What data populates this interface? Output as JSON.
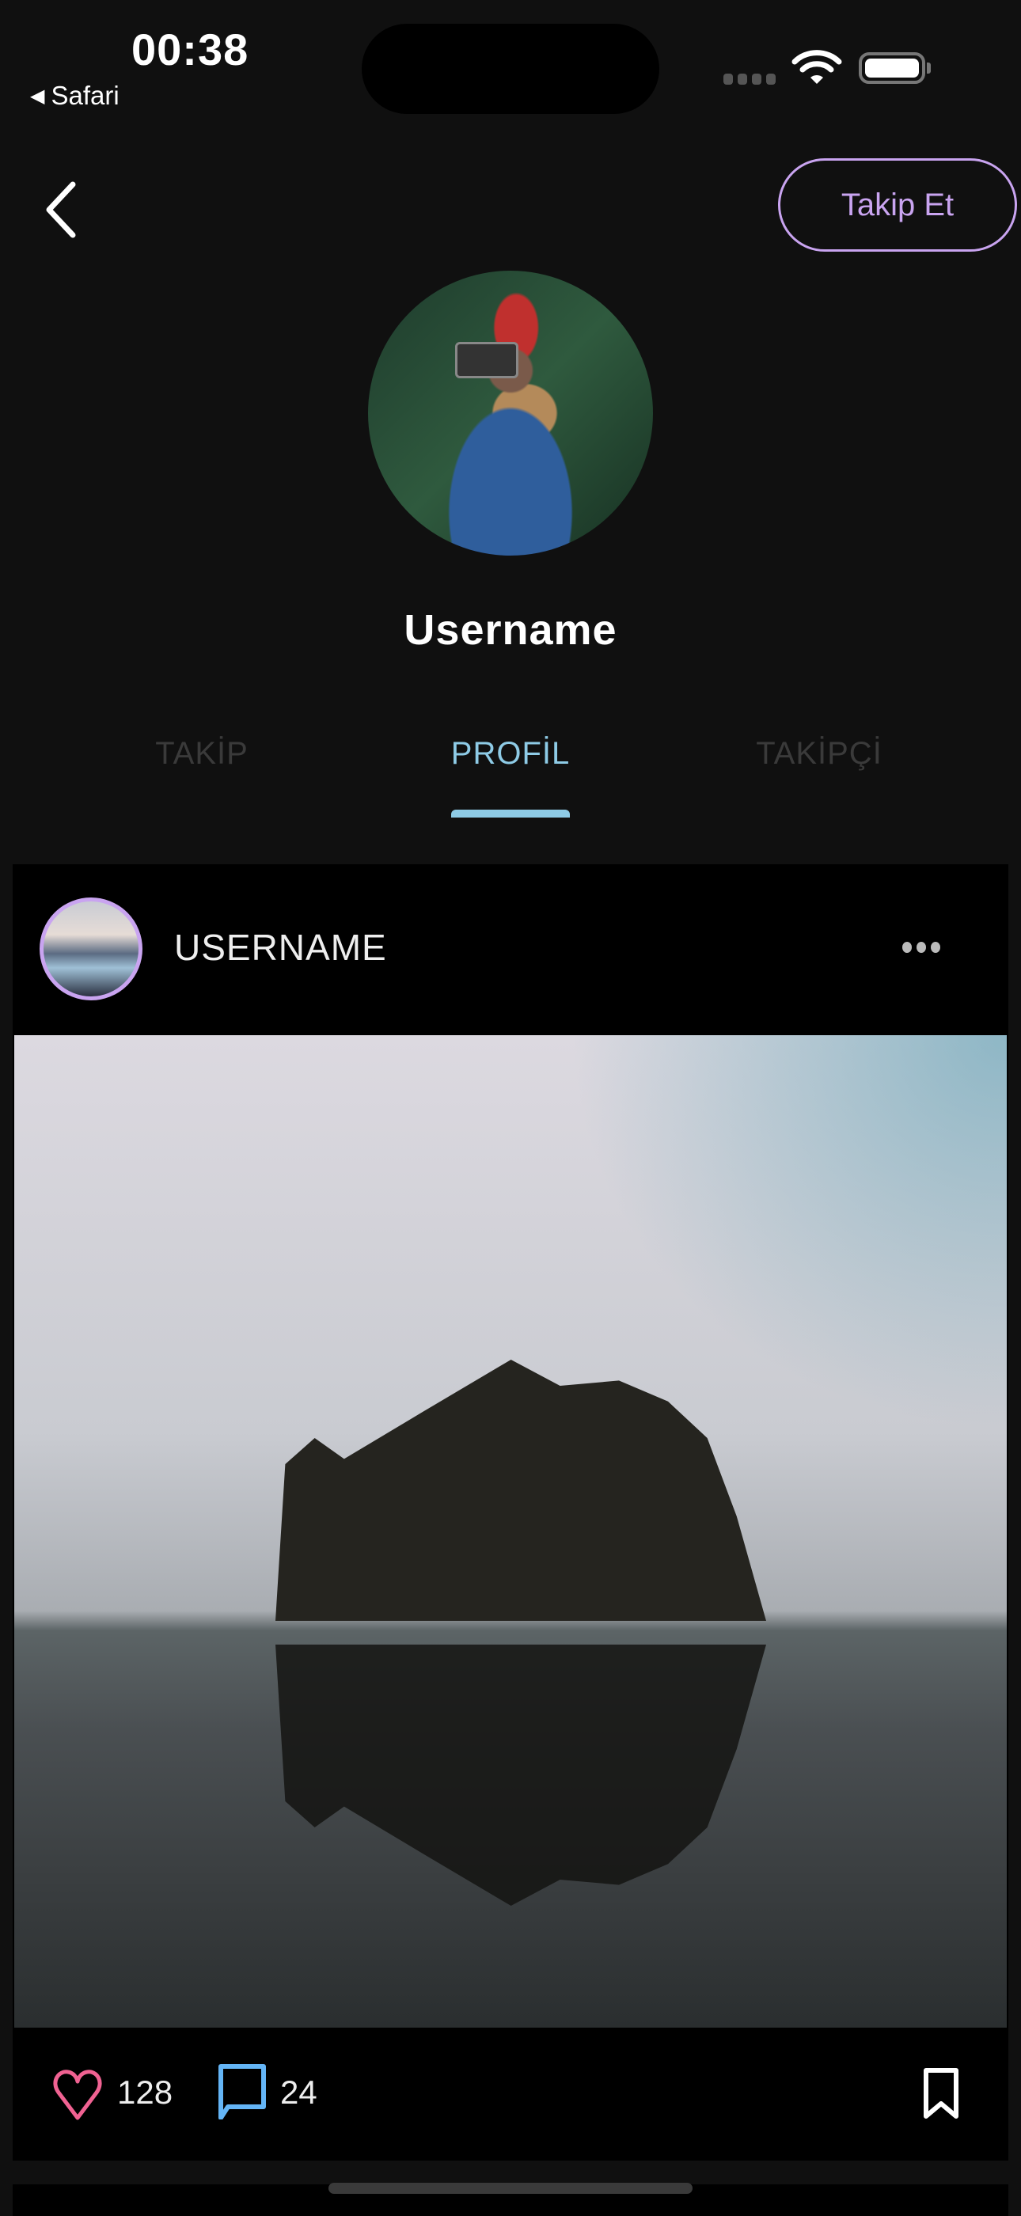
{
  "status_bar": {
    "time": "00:38",
    "back_app": "Safari"
  },
  "header": {
    "follow_label": "Takip Et"
  },
  "profile": {
    "username": "Username"
  },
  "tabs": [
    {
      "label": "TAKİP",
      "active": false
    },
    {
      "label": "PROFİL",
      "active": true
    },
    {
      "label": "TAKİPÇİ",
      "active": false
    }
  ],
  "post": {
    "username": "USERNAME",
    "likes": "128",
    "comments": "24"
  },
  "colors": {
    "accent_purple": "#c9a4f0",
    "tab_active": "#8ecbe6",
    "like": "#f06292",
    "comment": "#64b5f6"
  }
}
